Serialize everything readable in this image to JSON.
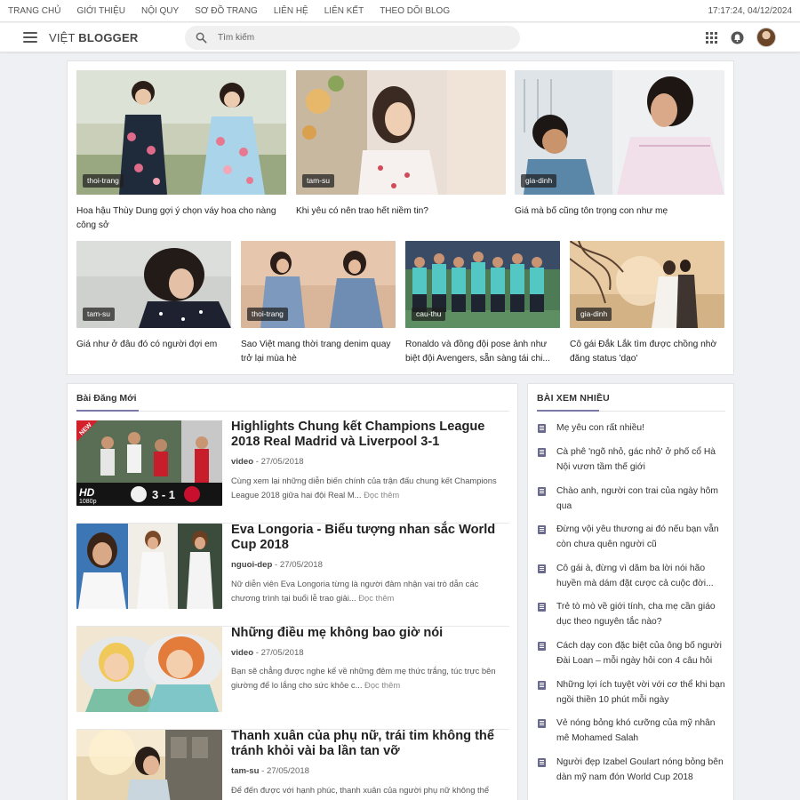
{
  "topnav": {
    "items": [
      "TRANG CHỦ",
      "GIỚI THIỆU",
      "NỘI QUY",
      "SƠ ĐỒ TRANG",
      "LIÊN HỆ",
      "LIÊN KẾT",
      "THEO DÕI BLOG"
    ],
    "clock": "17:17:24, 04/12/2024"
  },
  "header": {
    "logo_light": "VIỆT",
    "logo_bold": "BLOGGER",
    "search_placeholder": "Tìm kiếm",
    "icons": [
      "menu-icon",
      "search-icon",
      "apps-grid-icon",
      "notification-icon",
      "avatar"
    ]
  },
  "featured": [
    {
      "tag": "thoi-trang",
      "title": "Hoa hậu Thùy Dung gợi ý chọn váy hoa cho nàng công sở"
    },
    {
      "tag": "tam-su",
      "title": "Khi yêu có nên trao hết niềm tin?"
    },
    {
      "tag": "gia-dinh",
      "title": "Giá mà bố cũng tôn trọng con như mẹ"
    },
    {
      "tag": "tam-su",
      "title": "Giá như ở đâu đó có người đợi em"
    },
    {
      "tag": "thoi-trang",
      "title": "Sao Việt mang thời trang denim quay trở lại mùa hè"
    },
    {
      "tag": "cau-thu",
      "title": "Ronaldo và đồng đội pose ảnh như biệt đội Avengers, sẵn sàng tái chi..."
    },
    {
      "tag": "gia-dinh",
      "title": "Cô gái Đắk Lắk tìm được chồng nhờ đăng status 'dạo'"
    }
  ],
  "posts": {
    "heading": "Bài Đăng Mới",
    "items": [
      {
        "title": "Highlights Chung kết Champions League 2018 Real Madrid và Liverpool 3-1",
        "category": "video",
        "date": "27/05/2018",
        "desc": "Cùng xem lại những diễn biến chính của trận đấu chung kết Champions League 2018 giữa hai đội Real M...",
        "more": "Đọc thêm",
        "thumb_badge": "NEW",
        "thumb_hd": "HD",
        "thumb_res": "1080p",
        "thumb_score": "3 - 1"
      },
      {
        "title": "Eva Longoria - Biểu tượng nhan sắc World Cup 2018",
        "category": "nguoi-dep",
        "date": "27/05/2018",
        "desc": "Nữ diễn viên Eva Longoria từng là người đảm nhận vai trò dẫn các chương trình tại buổi lễ trao giải...",
        "more": "Đọc thêm"
      },
      {
        "title": "Những điều mẹ không bao giờ nói",
        "category": "video",
        "date": "27/05/2018",
        "desc": "Bạn sẽ chẳng được nghe kể về những đêm mẹ thức trắng, túc trực bên giường để lo lắng cho sức khỏe c...",
        "more": "Đọc thêm"
      },
      {
        "title": "Thanh xuân của phụ nữ, trái tim không thể tránh khỏi vài ba lần tan vỡ",
        "category": "tam-su",
        "date": "27/05/2018",
        "desc": "Để đến được với hạnh phúc, thanh xuân của người phụ nữ không thể",
        "more": ""
      }
    ]
  },
  "popular": {
    "heading": "BÀI XEM NHIỀU",
    "items": [
      "Mẹ yêu con rất nhiều!",
      "Cà phê 'ngõ nhỏ, gác nhỏ' ở phố cổ Hà Nội vươn tầm thế giới",
      "Chào anh, người con trai của ngày hôm qua",
      "Đừng vội yêu thương ai đó nếu bạn vẫn còn chưa quên người cũ",
      "Cô gái à, đừng vì dăm ba lời nói hão huyền mà dám đặt cược cả cuộc đời...",
      "Trẻ tò mò về giới tính, cha mẹ cần giáo dục theo nguyên tắc nào?",
      "Cách dạy con đặc biệt của ông bố người Đài Loan – mỗi ngày hỏi con 4 câu hỏi",
      "Những lợi ích tuyệt vời với cơ thể khi bạn ngồi thiền 10 phút mỗi ngày",
      "Vẻ nóng bỏng khó cưỡng của mỹ nhân mê Mohamed Salah",
      "Người đẹp Izabel Goulart nóng bỏng bên dàn mỹ nam đón World Cup 2018"
    ]
  },
  "colors": {
    "page_bg": "#eef0f4",
    "accent": "#7a7aa8",
    "doc_icon": "#6a6a8e"
  }
}
